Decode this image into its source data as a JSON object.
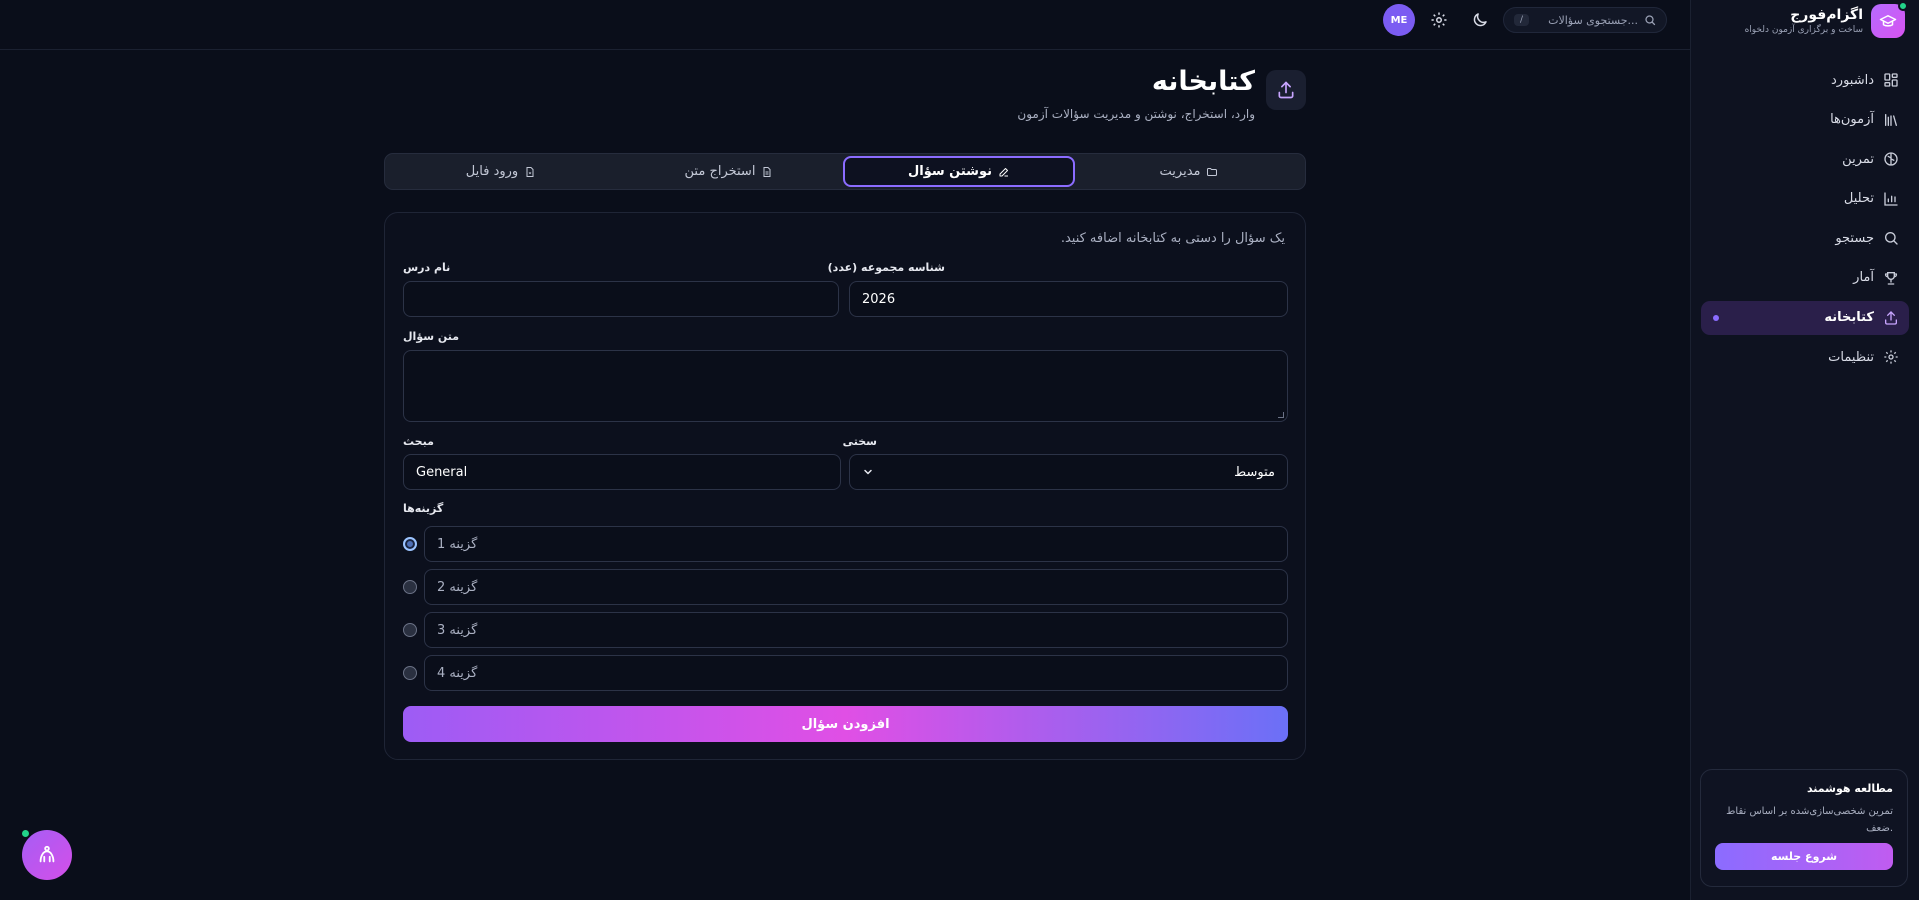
{
  "brand": {
    "name": "اگزام‌فورج",
    "tagline": "ساخت و برگزاری آزمون دلخواه"
  },
  "sidebar": {
    "items": [
      {
        "label": "داشبورد",
        "icon": "dashboard-icon",
        "active": false
      },
      {
        "label": "آزمون‌ها",
        "icon": "library-icon",
        "active": false
      },
      {
        "label": "تمرین",
        "icon": "brain-icon",
        "active": false
      },
      {
        "label": "تحلیل",
        "icon": "chart-icon",
        "active": false
      },
      {
        "label": "جستجو",
        "icon": "search-icon",
        "active": false
      },
      {
        "label": "آمار",
        "icon": "trophy-icon",
        "active": false
      },
      {
        "label": "کتابخانه",
        "icon": "upload-icon",
        "active": true
      },
      {
        "label": "تنظیمات",
        "icon": "gear-icon",
        "active": false
      }
    ]
  },
  "promo": {
    "title": "مطالعه هوشمند",
    "description": "تمرین شخصی‌سازی‌شده بر اساس نقاط ضعف.",
    "button": "شروع جلسه"
  },
  "header": {
    "search_placeholder": "جستجوی سؤالات...",
    "search_shortcut": "/",
    "avatar_initials": "ME"
  },
  "page": {
    "title": "کتابخانه",
    "subtitle": "وارد، استخراج، نوشتن و مدیریت سؤالات آزمون"
  },
  "tabs": [
    {
      "label": "مدیریت",
      "icon": "folder-icon",
      "active": false
    },
    {
      "label": "نوشتن سؤال",
      "icon": "pencil-icon",
      "active": true
    },
    {
      "label": "استخراج متن",
      "icon": "document-icon",
      "active": false
    },
    {
      "label": "ورود فایل",
      "icon": "file-icon",
      "active": false
    }
  ],
  "form": {
    "hint": "یک سؤال را دستی به کتابخانه اضافه کنید.",
    "set_id_label": "شناسه مجموعه (عدد)",
    "set_id_value": "2026",
    "course_label": "نام درس",
    "course_value": "",
    "question_label": "متن سؤال",
    "question_value": "",
    "difficulty_label": "سختی",
    "difficulty_value": "متوسط",
    "topic_label": "مبحث",
    "topic_value": "General",
    "options_label": "گزینه‌ها",
    "options": [
      "گزینه 1",
      "گزینه 2",
      "گزینه 3",
      "گزینه 4"
    ],
    "submit_label": "افزودن سؤال"
  },
  "colors": {
    "background": "#0a0e1a",
    "accent": "#8b6cff",
    "brand": "#c05cf0",
    "online": "#22d38a"
  }
}
